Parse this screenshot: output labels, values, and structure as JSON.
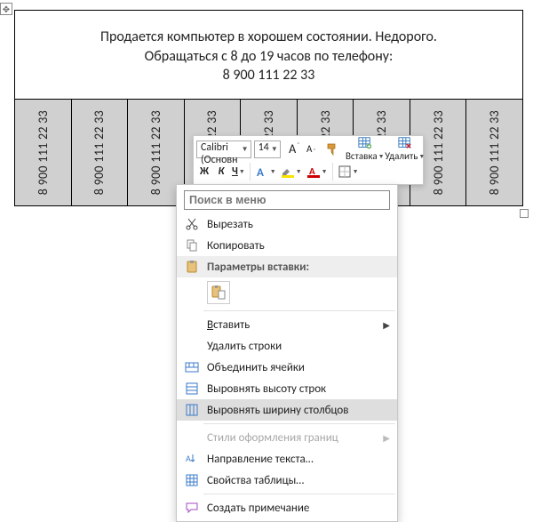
{
  "ad": {
    "line1": "Продается компьютер в хорошем состоянии. Недорого.",
    "line2": "Обращаться с 8 до 19 часов по телефону:",
    "phone": "8 900 111 22 33"
  },
  "tearoff_phone": "8 900 111 22 33",
  "mini_toolbar": {
    "font_name": "Calibri (Основн",
    "font_size": "14",
    "increase_font": "A",
    "decrease_font": "A",
    "bold": "Ж",
    "italic": "К",
    "underline": "Ч",
    "insert_label": "Вставка",
    "delete_label": "Удалить"
  },
  "context_menu": {
    "search_placeholder": "Поиск в меню",
    "cut": "Вырезать",
    "copy": "Копировать",
    "paste_options_label": "Параметры вставки:",
    "insert": "Вставить",
    "delete_rows": "Удалить строки",
    "merge_cells": "Объединить ячейки",
    "distribute_rows": "Выровнять высоту строк",
    "distribute_cols": "Выровнять ширину столбцов",
    "border_styles": "Стили оформления границ",
    "text_direction": "Направление текста…",
    "table_props": "Свойства таблицы…",
    "new_comment": "Создать примечание"
  }
}
